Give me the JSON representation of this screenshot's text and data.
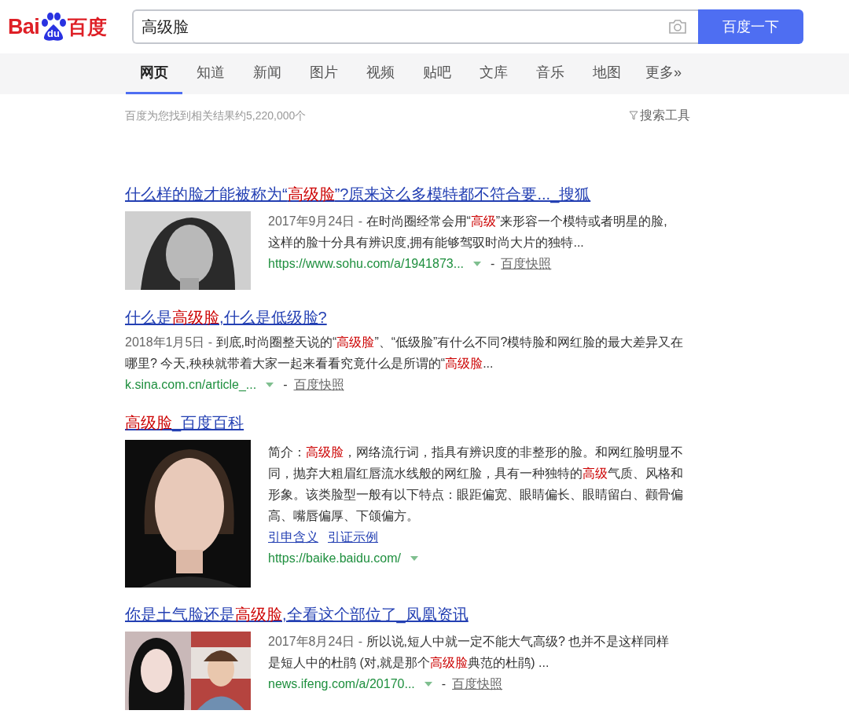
{
  "logo": {
    "left": "Bai",
    "mark": "du",
    "right": "百度"
  },
  "search": {
    "value": "高级脸",
    "button": "百度一下"
  },
  "tabs": [
    {
      "label": "网页",
      "selected": true
    },
    {
      "label": "知道",
      "selected": false
    },
    {
      "label": "新闻",
      "selected": false
    },
    {
      "label": "图片",
      "selected": false
    },
    {
      "label": "视频",
      "selected": false
    },
    {
      "label": "贴吧",
      "selected": false
    },
    {
      "label": "文库",
      "selected": false
    },
    {
      "label": "音乐",
      "selected": false
    },
    {
      "label": "地图",
      "selected": false
    },
    {
      "label": "更多»",
      "selected": false
    }
  ],
  "stats": "百度为您找到相关结果约5,220,000个",
  "tools": "搜索工具",
  "results": [
    {
      "title": [
        {
          "text": "什么样的脸才能被称为“",
          "hl": false
        },
        {
          "text": "高级脸",
          "hl": true
        },
        {
          "text": "”?原来这么多模特都不符合要..._搜狐",
          "hl": false
        }
      ],
      "date": "2017年9月24日 - ",
      "snippet": [
        {
          "text": "在时尚圈经常会用“",
          "hl": false
        },
        {
          "text": "高级",
          "hl": true
        },
        {
          "text": "”来形容一个模特或者明星的脸,这样的脸十分具有辨识度,拥有能够驾驭时尚大片的独特...",
          "hl": false
        }
      ],
      "url": "https://www.sohu.com/a/1941873...",
      "separator": "-",
      "snapshot": "百度快照"
    },
    {
      "kind": "text",
      "title": [
        {
          "text": "什么是",
          "hl": false
        },
        {
          "text": "高级脸",
          "hl": true
        },
        {
          "text": ",什么是低级脸?",
          "hl": false
        }
      ],
      "date": "2018年1月5日 - ",
      "snippet": [
        {
          "text": "到底,时尚圈整天说的“",
          "hl": false
        },
        {
          "text": "高级脸",
          "hl": true
        },
        {
          "text": "”、“低级脸”有什么不同?模特脸和网红脸的最大差异又在哪里? 今天,秧秧就带着大家一起来看看究竟什么是所谓的“",
          "hl": false
        },
        {
          "text": "高级脸",
          "hl": true
        },
        {
          "text": "...",
          "hl": false
        }
      ],
      "url": "k.sina.com.cn/article_...",
      "separator": "-",
      "snapshot": "百度快照"
    },
    {
      "kind": "encyclopedia",
      "title": [
        {
          "text": "高级脸",
          "hl": true
        },
        {
          "text": "_百度百科",
          "hl": false
        }
      ],
      "snippet": [
        {
          "text": "简介：",
          "hl": false
        },
        {
          "text": "高级脸",
          "hl": true
        },
        {
          "text": "，网络流行词，指具有辨识度的非整形的脸。和网红脸明显不同，抛弃大粗眉红唇流水线般的网红脸，具有一种独特的",
          "hl": false
        },
        {
          "text": "高级",
          "hl": true
        },
        {
          "text": "气质、风格和形象。该类脸型一般有以下特点：眼距偏宽、眼睛偏长、眼睛留白、颧骨偏高、嘴唇偏厚、下颌偏方。",
          "hl": false
        }
      ],
      "links": [
        "引申含义",
        "引证示例"
      ],
      "url": "https://baike.baidu.com/"
    },
    {
      "title": [
        {
          "text": "你是土气脸还是",
          "hl": false
        },
        {
          "text": "高级脸",
          "hl": true
        },
        {
          "text": ",全看这个部位了_凤凰资讯",
          "hl": false
        }
      ],
      "date": "2017年8月24日 - ",
      "snippet": [
        {
          "text": "所以说,短人中就一定不能大气高级? 也并不是这样同样是短人中的杜鹃 (对,就是那个",
          "hl": false
        },
        {
          "text": "高级脸",
          "hl": true
        },
        {
          "text": "典范的杜鹃) ...",
          "hl": false
        }
      ],
      "url": "news.ifeng.com/a/20170...",
      "separator": "-",
      "snapshot": "百度快照"
    }
  ]
}
